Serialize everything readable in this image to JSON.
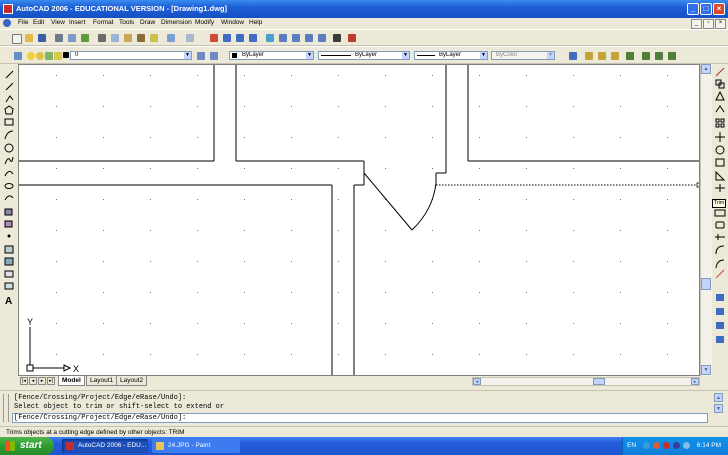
{
  "window": {
    "title": "AutoCAD 2006 - EDUCATIONAL VERSION - [Drawing1.dwg]",
    "min": "_",
    "max": "□",
    "close": "×"
  },
  "menu": [
    "File",
    "Edit",
    "View",
    "Insert",
    "Format",
    "Tools",
    "Draw",
    "Dimension",
    "Modify",
    "Window",
    "Help"
  ],
  "mdi": {
    "min": "_",
    "restore": "▫",
    "close": "×"
  },
  "properties": {
    "layer_value": "0",
    "color": "ByLayer",
    "linetype": "ByLayer",
    "lineweight": "ByLayer",
    "plotstyle": "ByColor"
  },
  "tooltip": "Trim",
  "ucs": {
    "x_label": "X",
    "y_label": "Y"
  },
  "layout_tabs": {
    "nav": [
      "|◂",
      "◂",
      "▸",
      "▸|"
    ],
    "tabs": [
      "Model",
      "Layout1",
      "Layout2"
    ]
  },
  "scroll": {
    "up": "▲",
    "down": "▼",
    "left": "◂",
    "right": "▸"
  },
  "command": {
    "line1": "[Fence/Crossing/Project/Edge/eRase/Undo]:",
    "line2": "Select object to trim or shift-select to extend or",
    "line3": "[Fence/Crossing/Project/Edge/eRase/Undo]:"
  },
  "status": "Trims objects at a cutting edge defined by other objects:  TRIM",
  "taskbar": {
    "start": "start",
    "items": [
      "AutoCAD 2006 - EDU...",
      "24.JPG - Paint"
    ],
    "lang": "EN",
    "clock": "6:14 PM"
  }
}
